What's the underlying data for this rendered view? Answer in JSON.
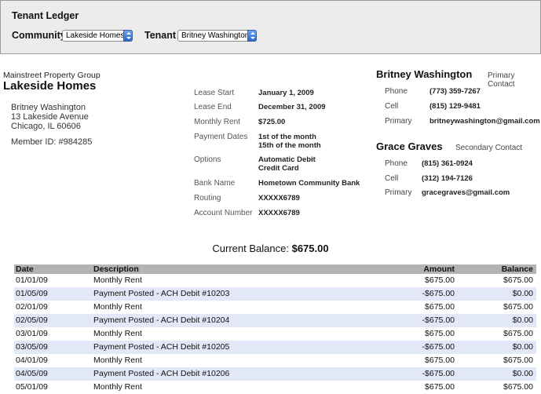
{
  "header": {
    "title": "Tenant Ledger",
    "community_label": "Community",
    "community_value": "Lakeside Homes",
    "tenant_label": "Tenant",
    "tenant_value": "Britney Washington"
  },
  "property": {
    "company": "Mainstreet Property Group",
    "community": "Lakeside Homes",
    "tenant_name": "Britney Washington",
    "address_line1": "13 Lakeside Avenue",
    "address_line2": "Chicago, IL 60606",
    "member_id": "Member ID: #984285"
  },
  "lease": [
    {
      "label": "Lease Start",
      "value": "January 1, 2009"
    },
    {
      "label": "Lease End",
      "value": "December 31, 2009"
    },
    {
      "label": "Monthly Rent",
      "value": "$725.00"
    },
    {
      "label": "Payment Dates",
      "value": "1st of the month",
      "value2": "15th of the month"
    },
    {
      "label": "Options",
      "value": "Automatic Debit",
      "value2": "Credit Card"
    },
    {
      "label": "Bank Name",
      "value": "Hometown Community Bank"
    },
    {
      "label": "Routing",
      "value": "XXXXX6789"
    },
    {
      "label": "Account Number",
      "value": "XXXXX6789"
    }
  ],
  "contacts": [
    {
      "name": "Britney Washington",
      "type": "Primary Contact",
      "fields": [
        {
          "label": "Phone",
          "value": "(773) 359-7267"
        },
        {
          "label": "Cell",
          "value": "(815) 129-9481"
        },
        {
          "label": "Primary",
          "value": "britneywashington@gmail.com"
        }
      ]
    },
    {
      "name": "Grace Graves",
      "type": "Secondary Contact",
      "fields": [
        {
          "label": "Phone",
          "value": "(815) 361-0924"
        },
        {
          "label": "Cell",
          "value": "(312) 194-7126"
        },
        {
          "label": "Primary",
          "value": "gracegraves@gmail.com"
        }
      ]
    }
  ],
  "balance": {
    "label": "Current Balance:",
    "amount": "$675.00"
  },
  "ledger": {
    "columns": [
      "Date",
      "Description",
      "Amount",
      "Balance"
    ],
    "rows": [
      {
        "date": "01/01/09",
        "description": "Monthly Rent",
        "amount": "$675.00",
        "balance": "$675.00"
      },
      {
        "date": "01/05/09",
        "description": "Payment Posted - ACH Debit #10203",
        "amount": "-$675.00",
        "balance": "$0.00"
      },
      {
        "date": "02/01/09",
        "description": "Monthly Rent",
        "amount": "$675.00",
        "balance": "$675.00"
      },
      {
        "date": "02/05/09",
        "description": "Payment Posted - ACH Debit #10204",
        "amount": "-$675.00",
        "balance": "$0.00"
      },
      {
        "date": "03/01/09",
        "description": "Monthly Rent",
        "amount": "$675.00",
        "balance": "$675.00"
      },
      {
        "date": "03/05/09",
        "description": "Payment Posted - ACH Debit #10205",
        "amount": "-$675.00",
        "balance": "$0.00"
      },
      {
        "date": "04/01/09",
        "description": "Monthly Rent",
        "amount": "$675.00",
        "balance": "$675.00"
      },
      {
        "date": "04/05/09",
        "description": "Payment Posted - ACH Debit #10206",
        "amount": "-$675.00",
        "balance": "$0.00"
      },
      {
        "date": "05/01/09",
        "description": "Monthly Rent",
        "amount": "$675.00",
        "balance": "$675.00"
      }
    ]
  }
}
